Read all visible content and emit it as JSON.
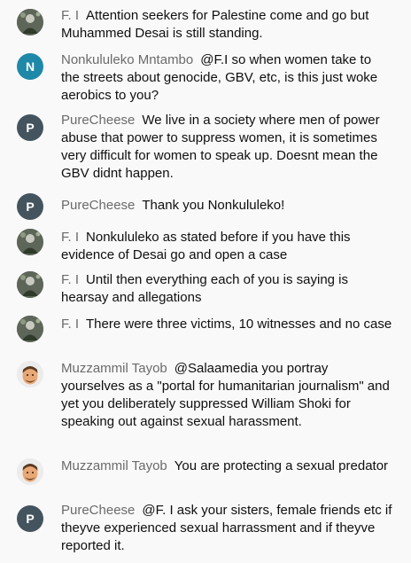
{
  "messages": [
    {
      "author": "F. I",
      "avatar": "photo",
      "text": "Attention seekers for Palestine come and go but Muhammed Desai is still standing."
    },
    {
      "author": "Nonkululeko Mntambo",
      "avatar": "letter",
      "letter": "N",
      "text": "@F.I so when women take to the streets about genocide, GBV, etc, is this just woke aerobics to you?"
    },
    {
      "author": "PureCheese",
      "avatar": "letter",
      "letter": "P",
      "text": "We live in a society where men of power abuse that power to suppress women, it is sometimes very difficult for women to speak up. Doesnt mean the GBV didnt happen."
    },
    {
      "author": "PureCheese",
      "avatar": "letter",
      "letter": "P",
      "text": "Thank you Nonkululeko!"
    },
    {
      "author": "F. I",
      "avatar": "photo",
      "text": "Nonkululeko as stated before if you have this evidence of Desai go and open a case"
    },
    {
      "author": "F. I",
      "avatar": "photo",
      "text": "Until then everything each of you is saying is hearsay and allegations"
    },
    {
      "author": "F. I",
      "avatar": "photo",
      "text": "There were three victims, 10 witnesses and no case"
    },
    {
      "author": "Muzzammil Tayob",
      "avatar": "memoji",
      "text": "@Salaamedia you portray yourselves as a \"portal for humanitarian journalism\" and yet you deliberately suppressed William Shoki for speaking out against sexual harassment."
    },
    {
      "author": "Muzzammil Tayob",
      "avatar": "memoji",
      "text": "You are protecting a sexual predator"
    },
    {
      "author": "PureCheese",
      "avatar": "letter",
      "letter": "P",
      "text": "@F. I ask your sisters, female friends etc if theyve experienced sexual harrassment and if theyve reported it."
    }
  ]
}
